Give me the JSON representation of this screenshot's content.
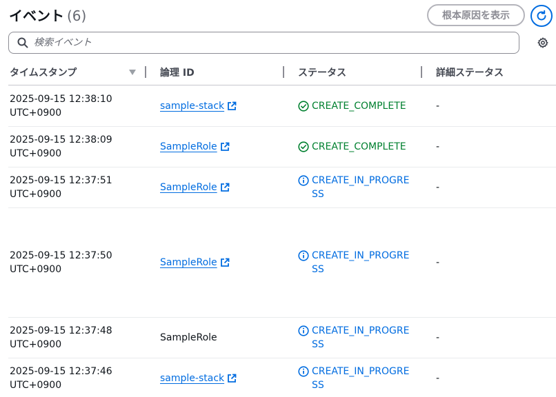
{
  "header": {
    "title": "イベント",
    "count": "(6)",
    "root_cause_label": "根本原因を表示"
  },
  "search": {
    "placeholder": "検索イベント",
    "value": ""
  },
  "columns": {
    "timestamp": "タイムスタンプ",
    "logical_id": "論理 ID",
    "status": "ステータス",
    "status_reason": "詳細ステータス"
  },
  "colors": {
    "link": "#006ce0",
    "success": "#00802f",
    "info": "#006ce0"
  },
  "rows": [
    {
      "ts_date": "2025-09-15 12:38:10",
      "ts_tz": "UTC+0900",
      "logical_id": "sample-stack",
      "status": "CREATE_COMPLETE",
      "status_icon": "check-circle-icon",
      "detail": "-"
    },
    {
      "ts_date": "2025-09-15 12:38:09",
      "ts_tz": "UTC+0900",
      "logical_id": "SampleRole",
      "status": "CREATE_COMPLETE",
      "status_icon": "check-circle-icon",
      "detail": "-"
    },
    {
      "ts_date": "2025-09-15 12:37:51",
      "ts_tz": "UTC+0900",
      "logical_id": "SampleRole",
      "status": "CREATE_IN_PROGRESS",
      "status_icon": "info-icon",
      "detail": "-"
    },
    {
      "ts_date": "2025-09-15 12:37:50",
      "ts_tz": "UTC+0900",
      "logical_id": "SampleRole",
      "status": "CREATE_IN_PROGRESS",
      "status_icon": "info-icon",
      "detail": "-"
    },
    {
      "ts_date": "2025-09-15 12:37:48",
      "ts_tz": "UTC+0900",
      "logical_id": "SampleRole",
      "status": "CREATE_IN_PROGRESS",
      "status_icon": "info-icon",
      "detail": "-"
    },
    {
      "ts_date": "2025-09-15 12:37:46",
      "ts_tz": "UTC+0900",
      "logical_id": "sample-stack",
      "status": "CREATE_IN_PROGRESS",
      "status_icon": "info-icon",
      "detail": "-"
    }
  ]
}
